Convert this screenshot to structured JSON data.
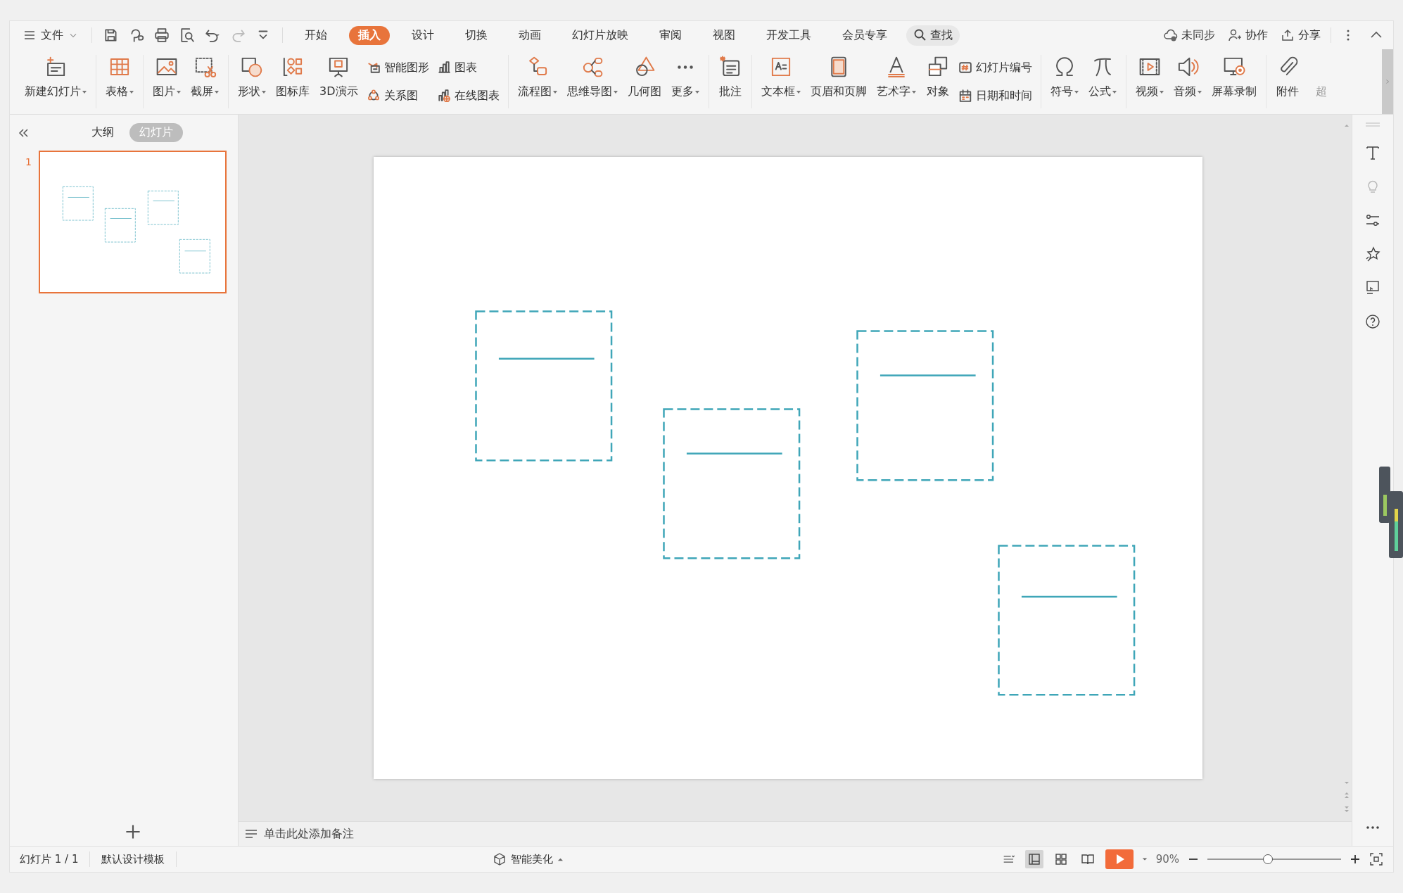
{
  "menu": {
    "file": "文件",
    "tabs": [
      {
        "label": "开始",
        "selected": false
      },
      {
        "label": "插入",
        "selected": true
      },
      {
        "label": "设计",
        "selected": false
      },
      {
        "label": "切换",
        "selected": false
      },
      {
        "label": "动画",
        "selected": false
      },
      {
        "label": "幻灯片放映",
        "selected": false
      },
      {
        "label": "审阅",
        "selected": false
      },
      {
        "label": "视图",
        "selected": false
      },
      {
        "label": "开发工具",
        "selected": false
      },
      {
        "label": "会员专享",
        "selected": false
      }
    ],
    "search": "查找",
    "actions": [
      "未同步",
      "协作",
      "分享"
    ]
  },
  "ribbon": {
    "groups": [
      [
        {
          "kind": "large",
          "label": "新建幻灯片",
          "dropdown": true,
          "disabled": false
        }
      ],
      [
        {
          "kind": "large",
          "label": "表格",
          "dropdown": true,
          "disabled": false
        }
      ],
      [
        {
          "kind": "large",
          "label": "图片",
          "dropdown": true,
          "disabled": false
        },
        {
          "kind": "large",
          "label": "截屏",
          "dropdown": true,
          "disabled": false
        }
      ],
      [
        {
          "kind": "large",
          "label": "形状",
          "dropdown": true,
          "disabled": false
        },
        {
          "kind": "large",
          "label": "图标库",
          "dropdown": false,
          "disabled": false
        },
        {
          "kind": "large",
          "label": "3D演示",
          "dropdown": false,
          "disabled": false
        },
        {
          "kind": "pair",
          "items": [
            "智能图形",
            "关系图"
          ]
        },
        {
          "kind": "pair",
          "items": [
            "图表",
            "在线图表"
          ]
        }
      ],
      [
        {
          "kind": "large",
          "label": "流程图",
          "dropdown": true,
          "disabled": false
        },
        {
          "kind": "large",
          "label": "思维导图",
          "dropdown": true,
          "disabled": false
        },
        {
          "kind": "large",
          "label": "几何图",
          "dropdown": false,
          "disabled": false
        },
        {
          "kind": "large",
          "label": "更多",
          "dropdown": true,
          "disabled": false
        }
      ],
      [
        {
          "kind": "large",
          "label": "批注",
          "dropdown": false,
          "disabled": false
        }
      ],
      [
        {
          "kind": "large",
          "label": "文本框",
          "dropdown": true,
          "disabled": false
        },
        {
          "kind": "large",
          "label": "页眉和页脚",
          "dropdown": false,
          "disabled": false
        },
        {
          "kind": "large",
          "label": "艺术字",
          "dropdown": true,
          "disabled": false
        },
        {
          "kind": "large",
          "label": "对象",
          "dropdown": false,
          "disabled": false
        },
        {
          "kind": "pair",
          "items": [
            "幻灯片编号",
            "日期和时间"
          ]
        }
      ],
      [
        {
          "kind": "large",
          "label": "符号",
          "dropdown": true,
          "disabled": false
        },
        {
          "kind": "large",
          "label": "公式",
          "dropdown": true,
          "disabled": false
        }
      ],
      [
        {
          "kind": "large",
          "label": "视频",
          "dropdown": true,
          "disabled": false
        },
        {
          "kind": "large",
          "label": "音频",
          "dropdown": true,
          "disabled": false
        },
        {
          "kind": "large",
          "label": "屏幕录制",
          "dropdown": false,
          "disabled": false
        }
      ],
      [
        {
          "kind": "large",
          "label": "附件",
          "dropdown": false,
          "disabled": false
        },
        {
          "kind": "large",
          "label": "超",
          "dropdown": false,
          "disabled": true
        }
      ]
    ]
  },
  "panel": {
    "tabs": [
      {
        "label": "大纲",
        "selected": false
      },
      {
        "label": "幻灯片",
        "selected": true
      }
    ],
    "slides": [
      {
        "number": "1",
        "selected": true
      }
    ]
  },
  "slide": {
    "shapes": [
      {
        "kind": "dashed-frame"
      },
      {
        "kind": "dashed-frame"
      },
      {
        "kind": "dashed-frame"
      },
      {
        "kind": "dashed-frame"
      }
    ]
  },
  "notes": {
    "placeholder": "单击此处添加备注"
  },
  "status": {
    "slide_count": "幻灯片 1 / 1",
    "template": "默认设计模板",
    "beautify": "智能美化",
    "view_buttons": [
      {
        "selected": true
      },
      {
        "selected": false
      },
      {
        "selected": false
      }
    ],
    "zoom": "90%",
    "zoom_slider": {
      "level": 0.45
    }
  }
}
